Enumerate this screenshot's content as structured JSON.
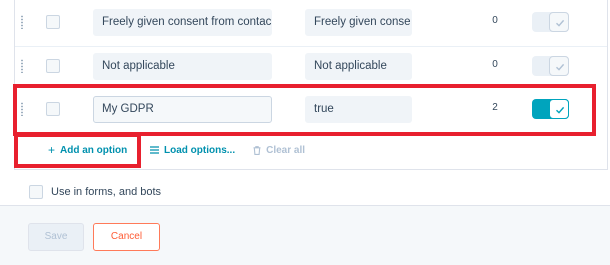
{
  "options": [
    {
      "label": "Freely given consent from contact",
      "value": "Freely given consent",
      "count": "0",
      "visible": false
    },
    {
      "label": "Not applicable",
      "value": "Not applicable",
      "count": "0",
      "visible": false
    },
    {
      "label": "My GDPR",
      "value": "true",
      "count": "2",
      "visible": true
    }
  ],
  "actions": {
    "add_option": "Add an option",
    "load_options": "Load options...",
    "clear_all": "Clear all"
  },
  "use_in_forms_label": "Use in forms, and bots",
  "footer": {
    "save_label": "Save",
    "cancel_label": "Cancel"
  },
  "colors": {
    "accent": "#00a4bd",
    "link": "#0091ae",
    "highlight": "#e8202e",
    "cancel": "#ff5c35"
  },
  "icons": {
    "add": "plus-icon",
    "load": "list-icon",
    "clear": "trash-icon",
    "toggle": "check-icon",
    "drag": "drag-handle-icon"
  }
}
